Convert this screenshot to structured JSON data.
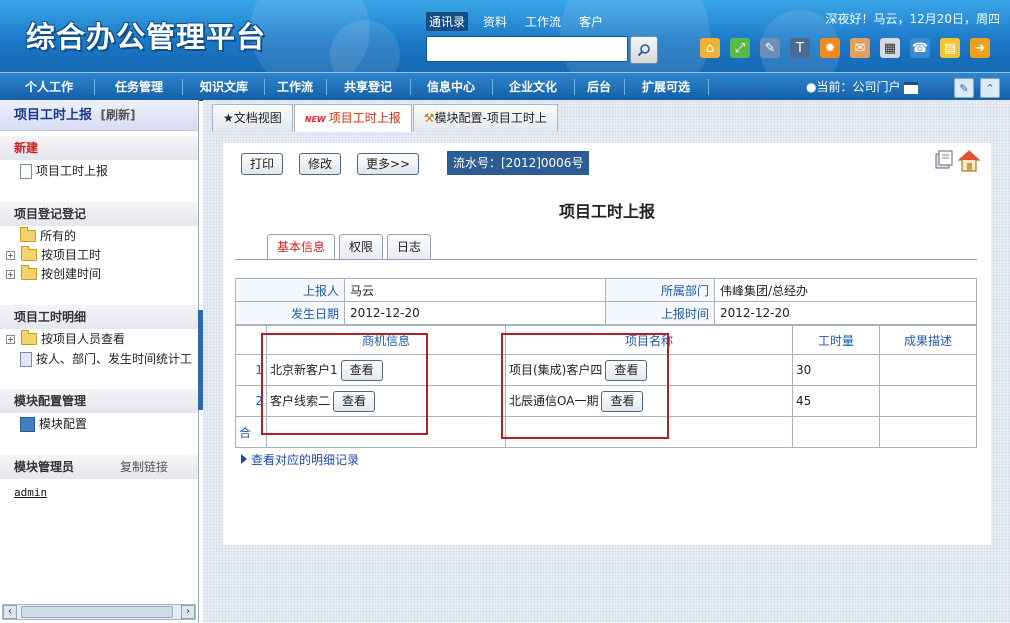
{
  "header": {
    "logo": "综合办公管理平台",
    "search_tabs": [
      "通讯录",
      "资料",
      "工作流",
      "客户"
    ],
    "greeting": "深夜好！马云，12月20日，周四"
  },
  "nav": {
    "items": [
      "个人工作",
      "任务管理",
      "知识文库",
      "工作流",
      "共享登记",
      "信息中心",
      "企业文化",
      "后台",
      "扩展可选"
    ],
    "portal": "●当前：公司门户"
  },
  "sidebar": {
    "title": "项目工时上报",
    "refresh": "[刷新]",
    "sections": {
      "new_title": "新建",
      "new_item": "项目工时上报",
      "register_title": "项目登记登记",
      "register_items": [
        "所有的",
        "按项目工时",
        "按创建时间"
      ],
      "detail_title": "项目工时明细",
      "detail_items": [
        "按项目人员查看",
        "按人、部门、发生时间统计工"
      ],
      "module_title": "模块配置管理",
      "module_item": "模块配置",
      "admin_title": "模块管理员",
      "copy_link": "复制链接",
      "admin_user": "admin"
    }
  },
  "tabs": [
    "★文档视图",
    "项目工时上报",
    "模块配置-项目工时上"
  ],
  "tab_new_badge": "NEW",
  "toolbar": {
    "print": "打印",
    "modify": "修改",
    "more": "更多>>",
    "serial": "流水号：[2012]0006号"
  },
  "form": {
    "title": "项目工时上报",
    "tabs": [
      "基本信息",
      "权限",
      "日志"
    ],
    "reporter_label": "上报人",
    "reporter": "马云",
    "dept_label": "所属部门",
    "dept": "伟峰集团/总经办",
    "date_label": "发生日期",
    "date": "2012-12-20",
    "report_time_label": "上报时间",
    "report_time": "2012-12-20",
    "columns": [
      "商机信息",
      "项目名称",
      "工时量",
      "成果描述"
    ],
    "rows": [
      {
        "no": "1",
        "biz": "北京新客户1",
        "project": "项目(集成)客户四",
        "hours": "30",
        "result": ""
      },
      {
        "no": "2",
        "biz": "客户线索二",
        "project": "北辰通信OA一期",
        "hours": "45",
        "result": ""
      }
    ],
    "total_label": "合",
    "view_btn": "查看",
    "more_link": "查看对应的明细记录"
  }
}
